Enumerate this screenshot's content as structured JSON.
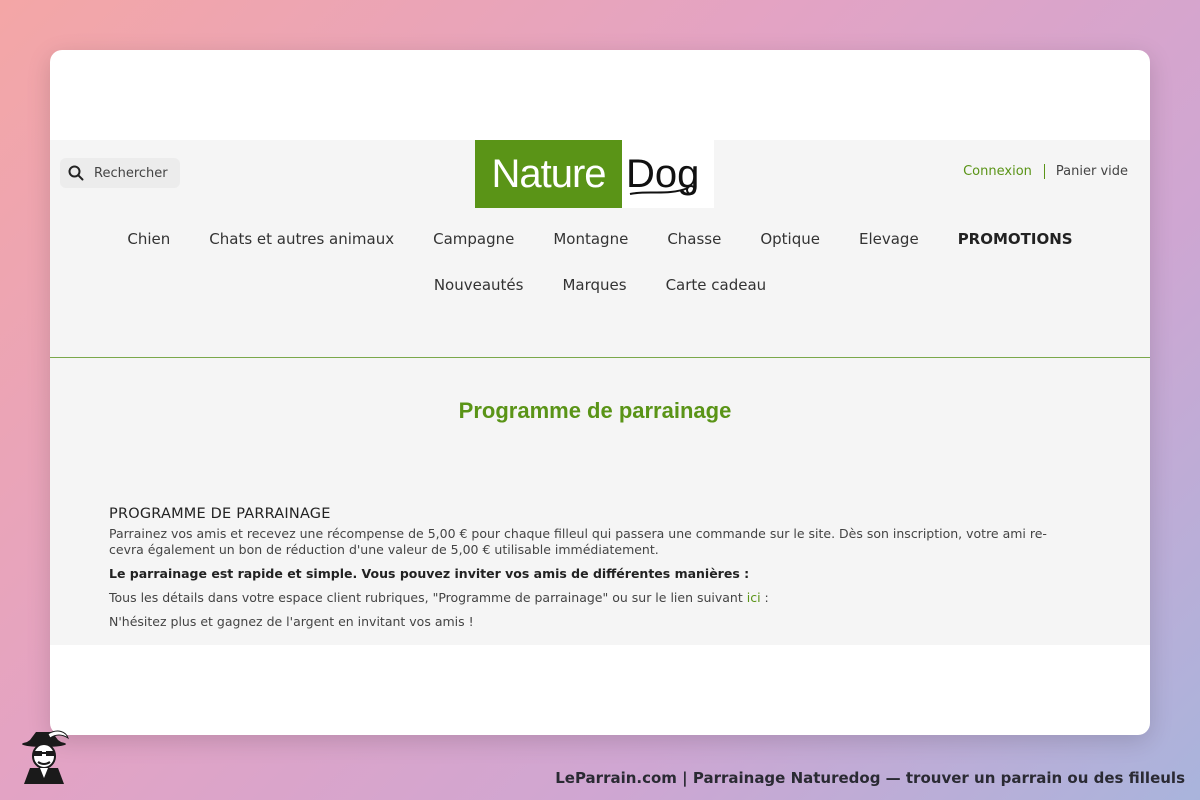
{
  "header": {
    "search_placeholder": "Rechercher",
    "logo": {
      "left_text": "Nature",
      "right_text": "Dog"
    },
    "login_label": "Connexion",
    "cart_label": "Panier vide"
  },
  "nav": {
    "row1": [
      "Chien",
      "Chats et autres animaux",
      "Campagne",
      "Montagne",
      "Chasse",
      "Optique",
      "Elevage",
      "PROMOTIONS"
    ],
    "row2": [
      "Nouveautés",
      "Marques",
      "Carte cadeau"
    ]
  },
  "main": {
    "page_title": "Programme de parrainage",
    "section_title": "PROGRAMME DE PARRAINAGE",
    "intro": "Parrainez vos amis et recevez une récompense de 5,00 € pour chaque filleul qui passera une commande sur le site. Dès son inscription, votre ami re-cevra également un bon de réduction d'une valeur de 5,00 € utilisable immédiatement.",
    "bold_line": "Le parrainage est rapide et simple. Vous pouvez inviter vos amis de différentes manières :",
    "details_prefix": "Tous les détails dans votre espace client rubriques, \"Programme de parrainage\" ou sur le lien suivant ",
    "details_link": "ici",
    "details_suffix": " :",
    "closing": "N'hésitez plus et gagnez de l'argent en invitant vos amis !"
  },
  "footer": {
    "caption": "LeParrain.com | Parrainage Naturedog — trouver un parrain ou des filleuls"
  },
  "colors": {
    "brand_green": "#5a9417",
    "card_bg": "#ffffff",
    "site_bg": "#f5f5f5"
  },
  "icons": [
    "search-icon",
    "mascot-icon"
  ]
}
